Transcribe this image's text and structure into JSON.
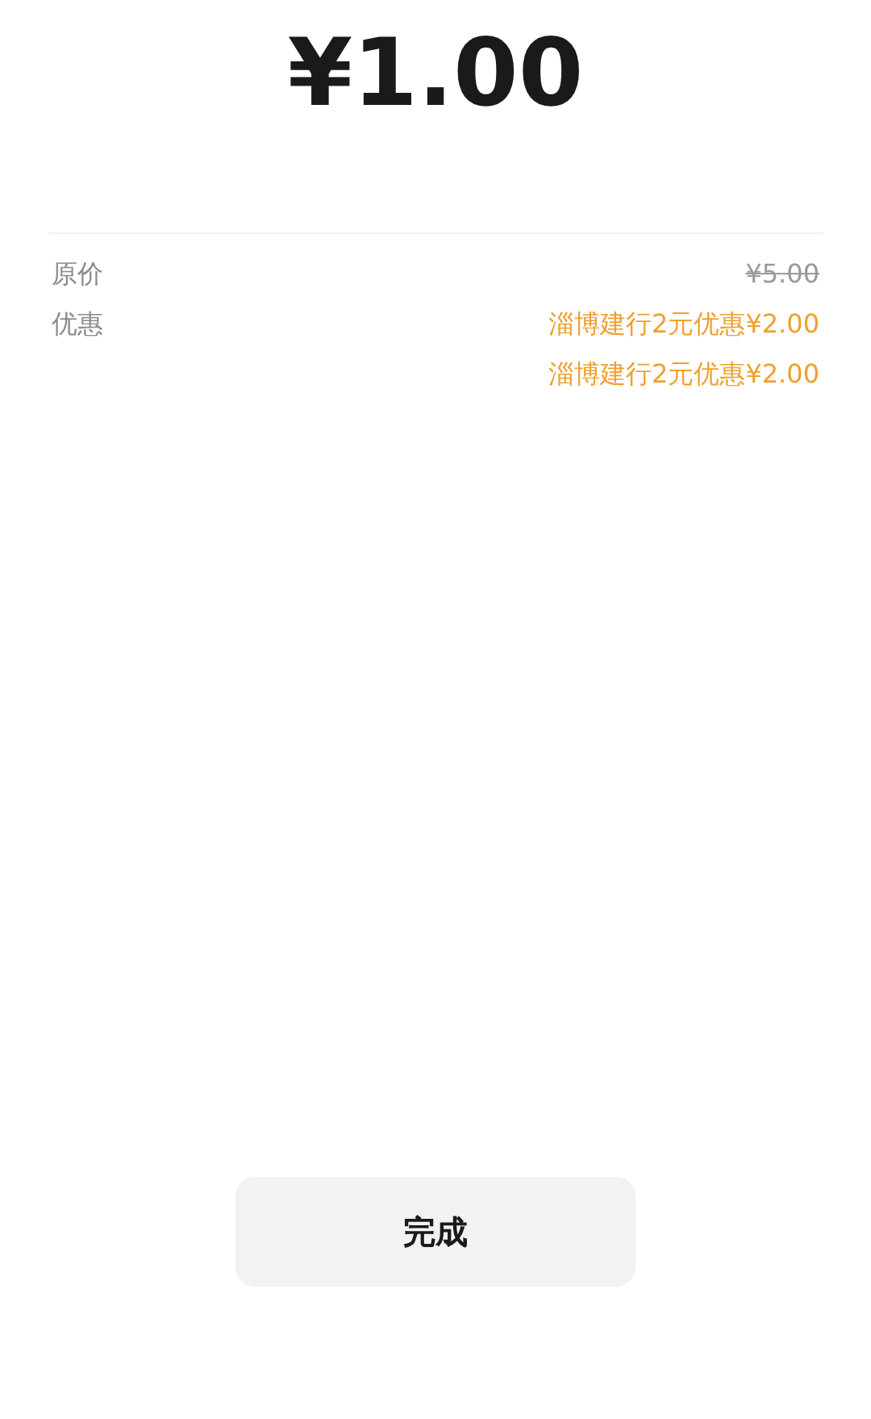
{
  "amount": "¥1.00",
  "rows": [
    {
      "label": "原价",
      "values": [
        {
          "text": "¥5.00",
          "kind": "struck"
        }
      ]
    },
    {
      "label": "优惠",
      "values": [
        {
          "text": "淄博建行2元优惠¥2.00",
          "kind": "discount"
        },
        {
          "text": "淄博建行2元优惠¥2.00",
          "kind": "discount"
        }
      ]
    }
  ],
  "button": "完成"
}
